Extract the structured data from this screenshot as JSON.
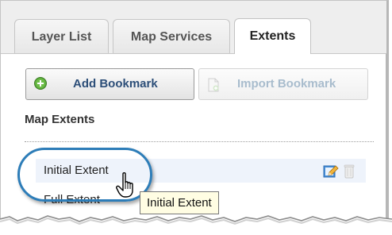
{
  "tabs": [
    {
      "label": "Layer List",
      "active": false
    },
    {
      "label": "Map Services",
      "active": false
    },
    {
      "label": "Extents",
      "active": true
    }
  ],
  "toolbar": {
    "add_bookmark_label": "Add Bookmark",
    "import_bookmark_label": "Import Bookmark",
    "import_bookmark_enabled": false
  },
  "section": {
    "title": "Map Extents"
  },
  "extents": [
    {
      "label": "Initial Extent",
      "hovered": true
    },
    {
      "label": "Full Extent",
      "hovered": false
    }
  ],
  "tooltip": {
    "text": "Initial Extent"
  },
  "icons": {
    "add": "plus-circle-icon",
    "import": "import-document-icon",
    "edit": "edit-pencil-icon",
    "delete": "trash-can-icon",
    "cursor": "hand-pointer-icon"
  },
  "colors": {
    "accent_button_text": "#2c4e78",
    "disabled_button_text": "#a8bccd",
    "add_icon_green": "#5aa83a",
    "highlight_oval": "#2d7db8",
    "row_hover": "#eef3fb",
    "tooltip_background": "#fffde3"
  }
}
